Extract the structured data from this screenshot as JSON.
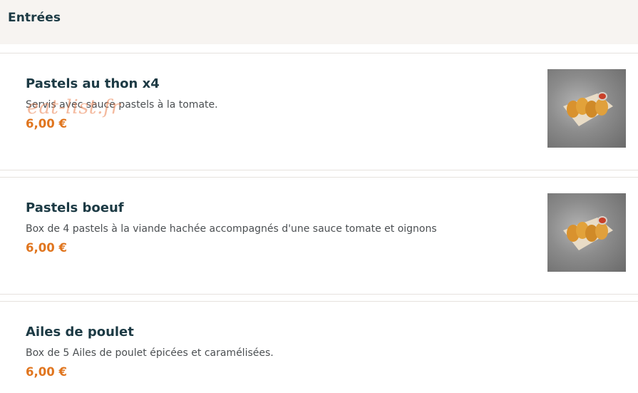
{
  "section": {
    "title": "Entrées"
  },
  "watermark": "eat-list.fr",
  "items": [
    {
      "name": "Pastels au thon x4",
      "description": "Servis avec sauce pastels à la tomate.",
      "price": "6,00 €",
      "has_image": true
    },
    {
      "name": "Pastels boeuf",
      "description": "Box de 4 pastels à la viande hachée accompagnés d'une sauce tomate et oignons",
      "price": "6,00 €",
      "has_image": true
    },
    {
      "name": "Ailes de poulet",
      "description": "Box de 5 Ailes de poulet épicées et caramélisées.",
      "price": "6,00 €",
      "has_image": false
    }
  ]
}
